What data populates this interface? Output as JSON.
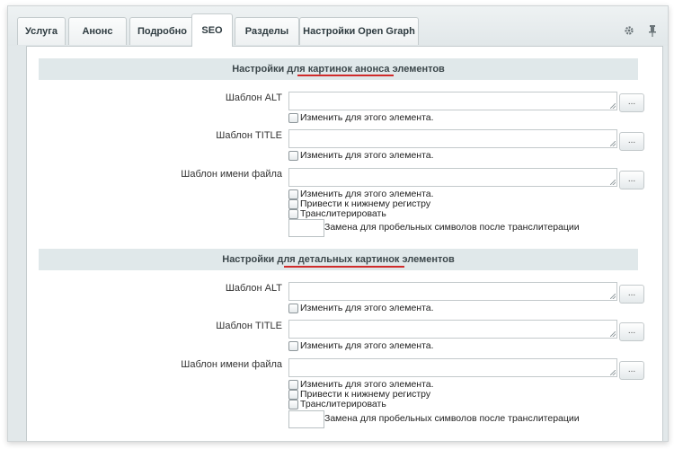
{
  "tabs": [
    {
      "label": "Услуга"
    },
    {
      "label": "Анонс"
    },
    {
      "label": "Подробно"
    },
    {
      "label": "SEO"
    },
    {
      "label": "Разделы"
    },
    {
      "label": "Настройки Open Graph"
    }
  ],
  "active_tab": "SEO",
  "tools": {
    "settings_icon": "gear-icon",
    "pin_icon": "pin-icon"
  },
  "accent_color": "#d02b2b",
  "sections": [
    {
      "title_prefix": "Настройки для ",
      "title_highlight": "картинок анонса",
      "title_suffix": " элементов",
      "fields": {
        "alt_label": "Шаблон ALT",
        "alt_value": "",
        "alt_checkbox": "Изменить для этого элемента.",
        "title_label": "Шаблон TITLE",
        "title_value": "",
        "title_checkbox": "Изменить для этого элемента.",
        "filename_label": "Шаблон имени файла",
        "filename_value": "",
        "filename_checkboxes": [
          "Изменить для этого элемента.",
          "Привести к нижнему регистру",
          "Транслитерировать"
        ],
        "space_replace_value": "",
        "space_replace_label": "Замена для пробельных символов после транслитерации"
      },
      "dots_label": "..."
    },
    {
      "title_prefix": "Настройки для ",
      "title_highlight": "детальных картинок",
      "title_suffix": " элементов",
      "fields": {
        "alt_label": "Шаблон ALT",
        "alt_value": "",
        "alt_checkbox": "Изменить для этого элемента.",
        "title_label": "Шаблон TITLE",
        "title_value": "",
        "title_checkbox": "Изменить для этого элемента.",
        "filename_label": "Шаблон имени файла",
        "filename_value": "",
        "filename_checkboxes": [
          "Изменить для этого элемента.",
          "Привести к нижнему регистру",
          "Транслитерировать"
        ],
        "space_replace_value": "",
        "space_replace_label": "Замена для пробельных символов после транслитерации"
      },
      "dots_label": "..."
    }
  ]
}
